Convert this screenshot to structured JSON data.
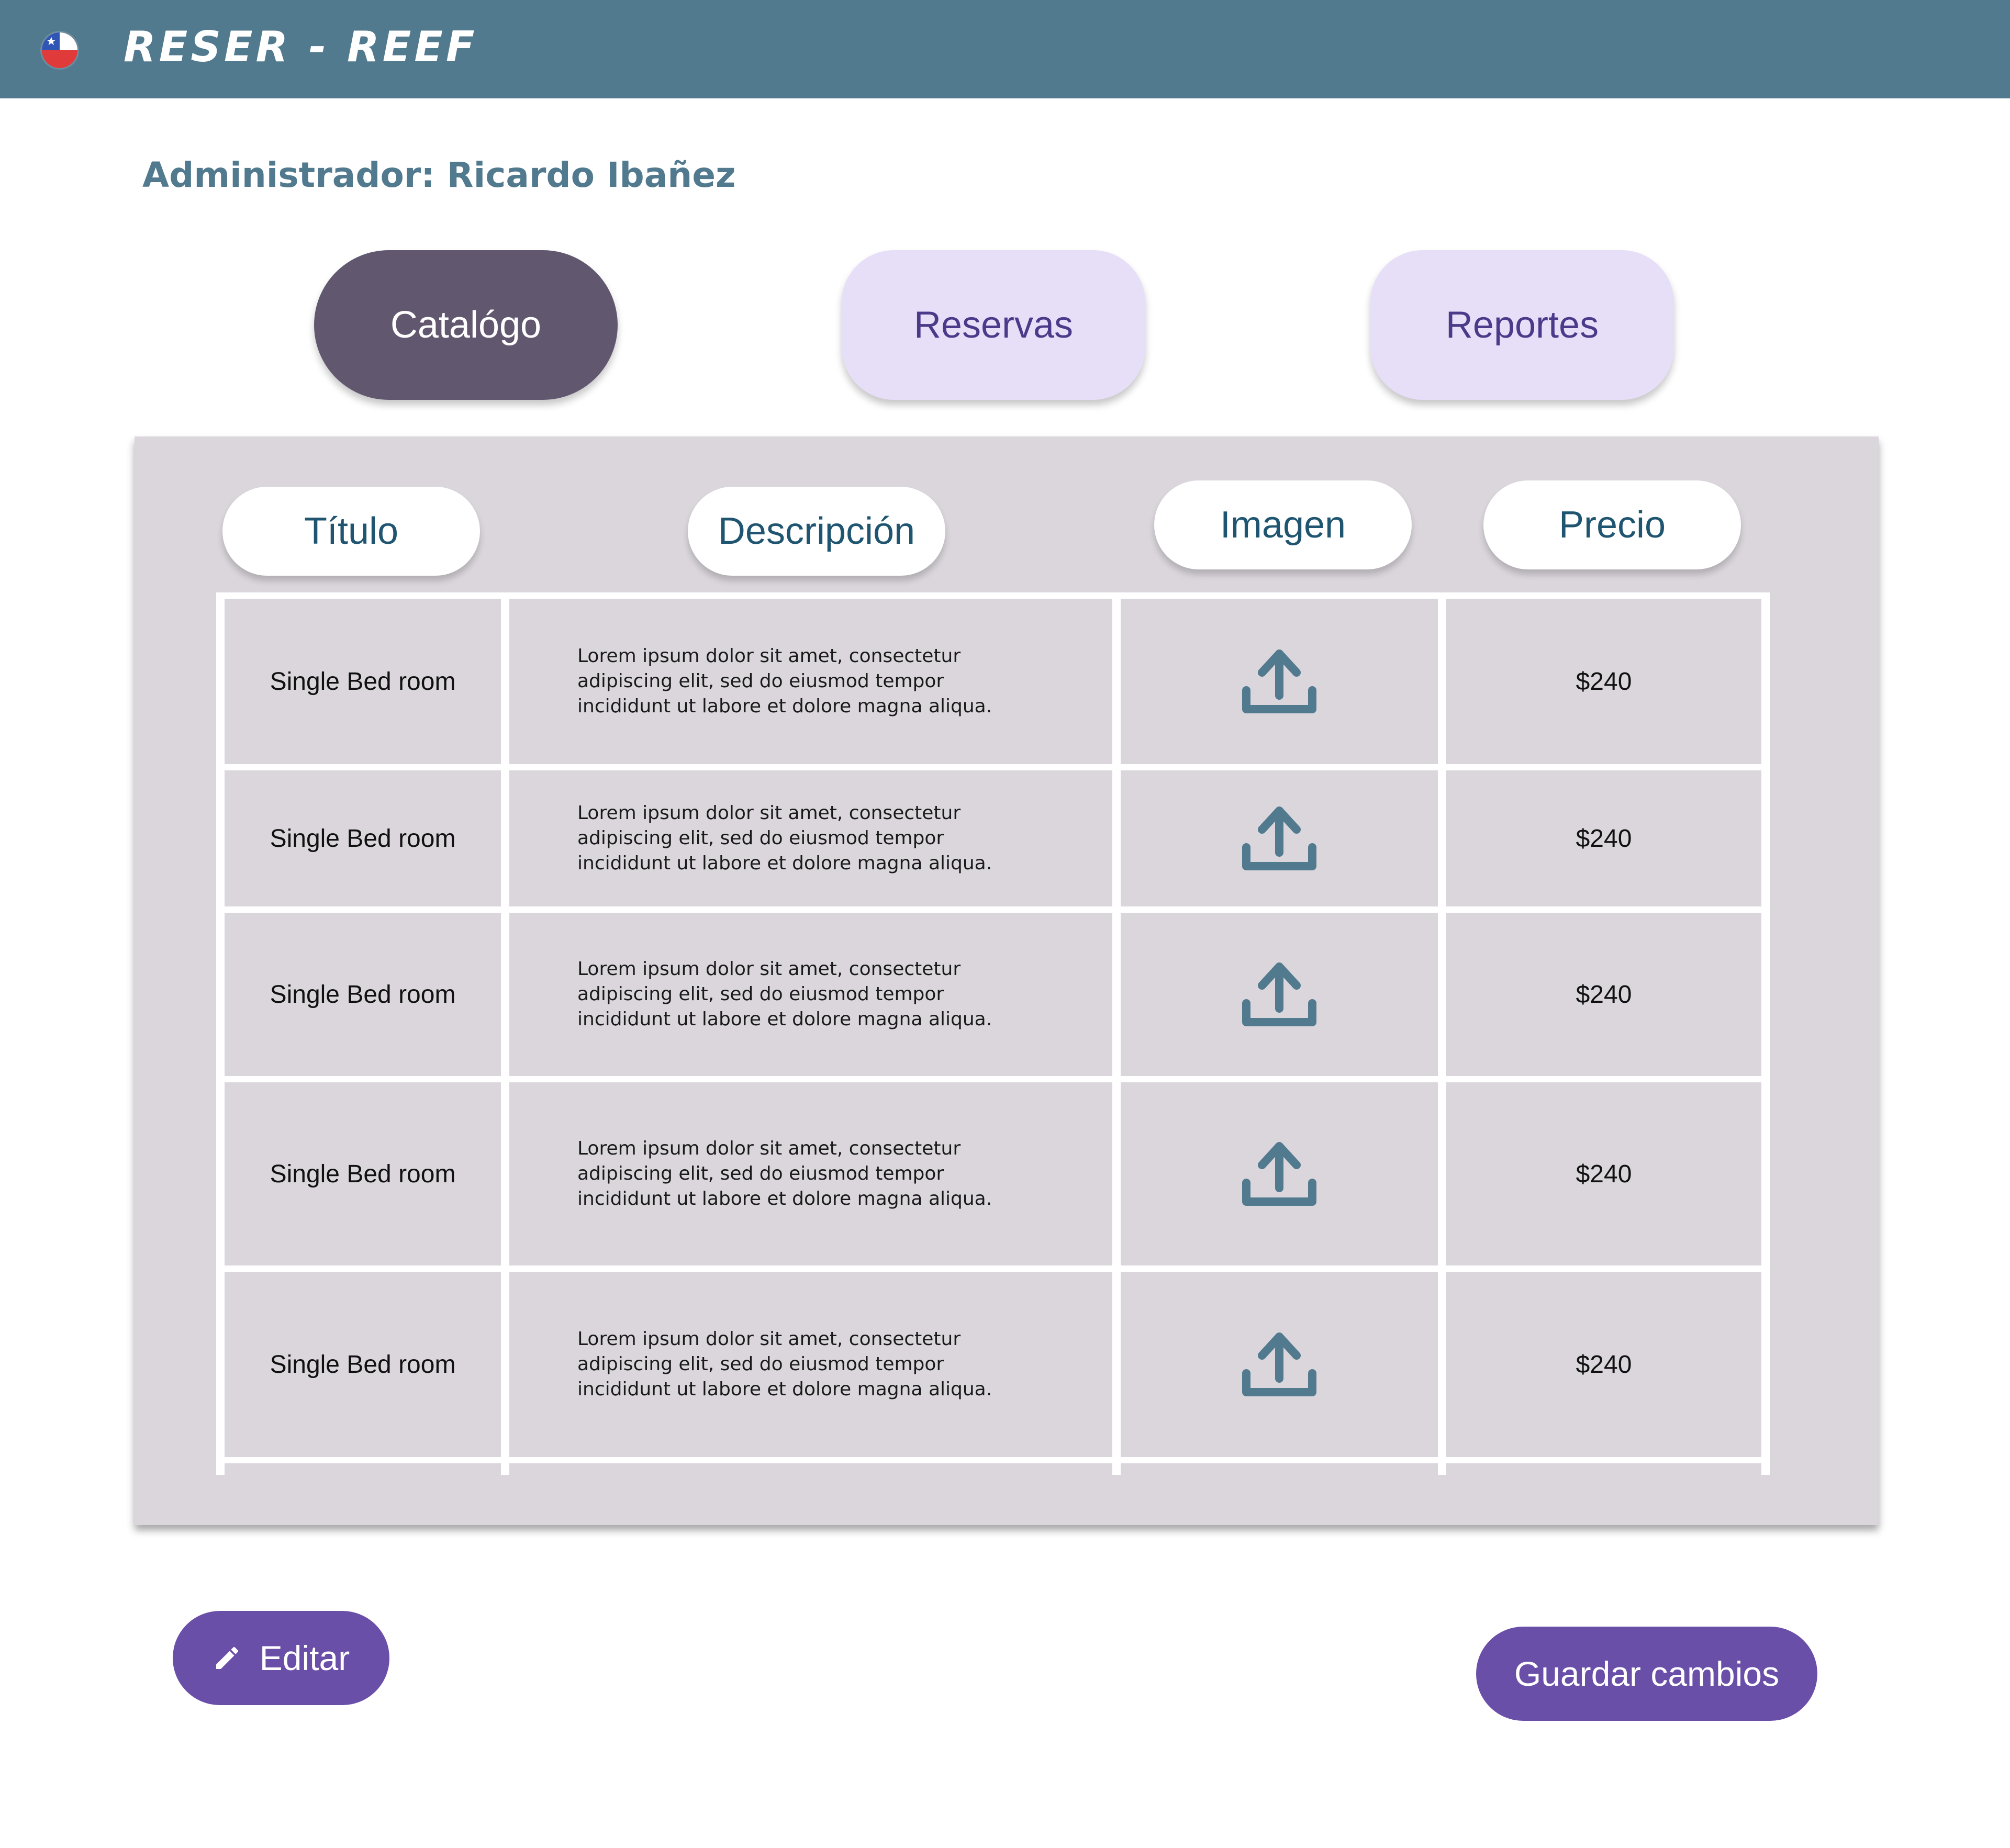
{
  "header": {
    "brand": "RESER - REEF",
    "flag_icon": "chile-flag-icon"
  },
  "admin_label": "Administrador: Ricardo Ibañez",
  "tabs": [
    {
      "label": "Catalógo",
      "active": true
    },
    {
      "label": "Reservas",
      "active": false
    },
    {
      "label": "Reportes",
      "active": false
    }
  ],
  "table": {
    "columns": [
      "Título",
      "Descripción",
      "Imagen",
      "Precio"
    ],
    "rows": [
      {
        "title": "Single Bed room",
        "description": "Lorem ipsum dolor sit amet, consectetur adipiscing elit, sed do eiusmod tempor incididunt ut labore et dolore magna aliqua.",
        "image_icon": "upload-icon",
        "price": "$240"
      },
      {
        "title": "Single Bed room",
        "description": "Lorem ipsum dolor sit amet, consectetur adipiscing elit, sed do eiusmod tempor incididunt ut labore et dolore magna aliqua.",
        "image_icon": "upload-icon",
        "price": "$240"
      },
      {
        "title": "Single Bed room",
        "description": "Lorem ipsum dolor sit amet, consectetur adipiscing elit, sed do eiusmod tempor incididunt ut labore et dolore magna aliqua.",
        "image_icon": "upload-icon",
        "price": "$240"
      },
      {
        "title": "Single Bed room",
        "description": "Lorem ipsum dolor sit amet, consectetur adipiscing elit, sed do eiusmod tempor incididunt ut labore et dolore magna aliqua.",
        "image_icon": "upload-icon",
        "price": "$240"
      },
      {
        "title": "Single Bed room",
        "description": "Lorem ipsum dolor sit amet, consectetur adipiscing elit, sed do eiusmod tempor incididunt ut labore et dolore magna aliqua.",
        "image_icon": "upload-icon",
        "price": "$240"
      }
    ]
  },
  "actions": {
    "edit_label": "Editar",
    "edit_icon": "pencil-icon",
    "save_label": "Guardar cambios"
  },
  "colors": {
    "header_bg": "#527a8f",
    "active_tab": "#615870",
    "inactive_tab": "#e6dff7",
    "panel_bg": "#dad6dc",
    "primary_button": "#6a4fa8",
    "icon": "#527a8f"
  }
}
